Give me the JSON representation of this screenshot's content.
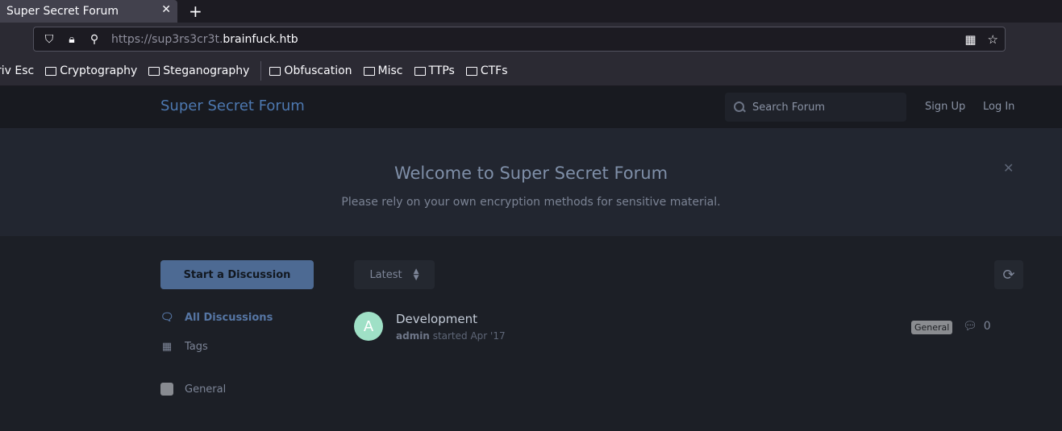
{
  "browser": {
    "tab_title": "Super Secret Forum",
    "url_scheme_path": "https://sup3rs3cr3t.",
    "url_host": "brainfuck.htb",
    "bookmarks": [
      {
        "label": "riv Esc",
        "folder": false
      },
      {
        "label": "Cryptography",
        "folder": true
      },
      {
        "label": "Steganography",
        "folder": true
      },
      {
        "label": "Obfuscation",
        "folder": true
      },
      {
        "label": "Misc",
        "folder": true
      },
      {
        "label": "TTPs",
        "folder": true
      },
      {
        "label": "CTFs",
        "folder": true
      }
    ]
  },
  "header": {
    "forum_title": "Super Secret Forum",
    "search_placeholder": "Search Forum",
    "sign_up": "Sign Up",
    "log_in": "Log In"
  },
  "hero": {
    "title": "Welcome to Super Secret Forum",
    "subtitle": "Please rely on your own encryption methods for sensitive material."
  },
  "sidebar": {
    "start_button": "Start a Discussion",
    "all_discussions": "All Discussions",
    "tags": "Tags",
    "general": "General"
  },
  "toolbar": {
    "sort_label": "Latest"
  },
  "discussion": {
    "avatar_letter": "A",
    "title": "Development",
    "author": "admin",
    "meta": "started Apr '17",
    "tag": "General",
    "replies": "0"
  },
  "colors": {
    "accent": "#4d78b0",
    "avatar": "#9fe0c6",
    "tag_general": "#888b91"
  }
}
